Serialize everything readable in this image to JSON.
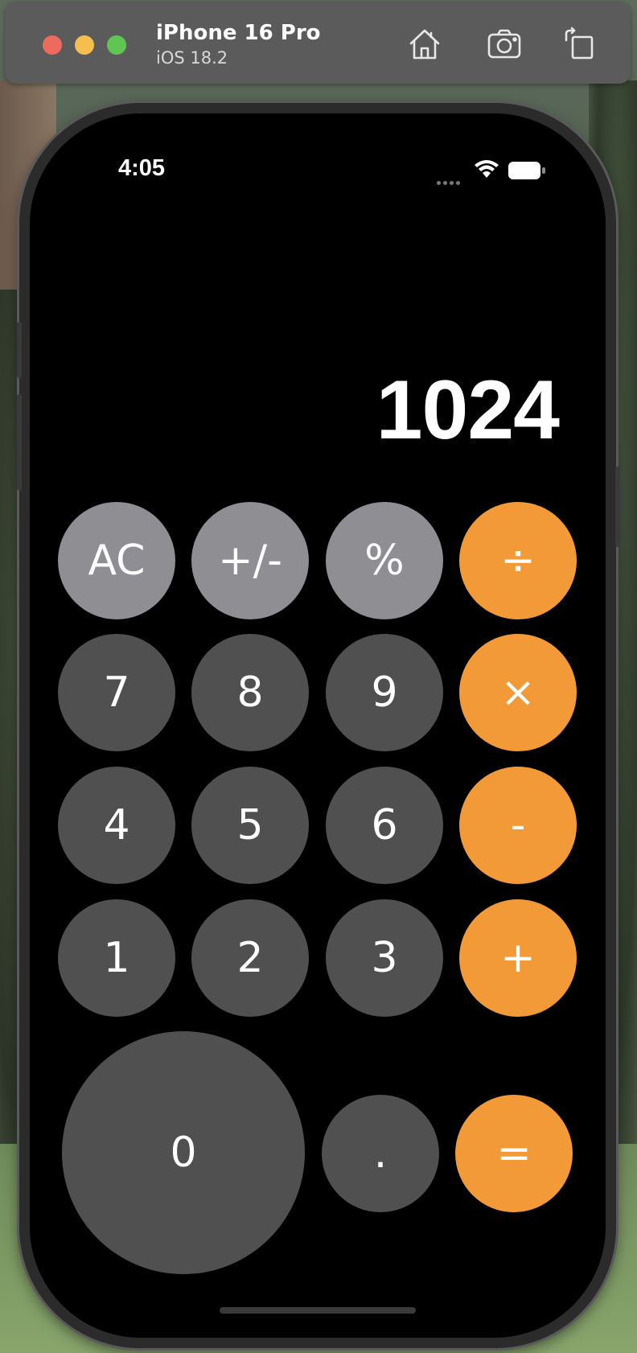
{
  "simulator": {
    "device_name": "iPhone 16 Pro",
    "os_version": "iOS 18.2",
    "tools": [
      {
        "icon": "home-icon"
      },
      {
        "icon": "screenshot-icon"
      },
      {
        "icon": "rotate-icon"
      }
    ]
  },
  "status_bar": {
    "time": "4:05"
  },
  "display": {
    "value": "1024"
  },
  "keys": {
    "ac": "AC",
    "sign": "+/-",
    "percent": "%",
    "divide": "÷",
    "seven": "7",
    "eight": "8",
    "nine": "9",
    "multiply": "×",
    "four": "4",
    "five": "5",
    "six": "6",
    "minus": "-",
    "one": "1",
    "two": "2",
    "three": "3",
    "plus": "+",
    "zero": "0",
    "decimal": ".",
    "equals": "="
  },
  "colors": {
    "operator": "#f29a37",
    "function": "#8e8e93",
    "digit": "#505050",
    "background": "#000000"
  }
}
